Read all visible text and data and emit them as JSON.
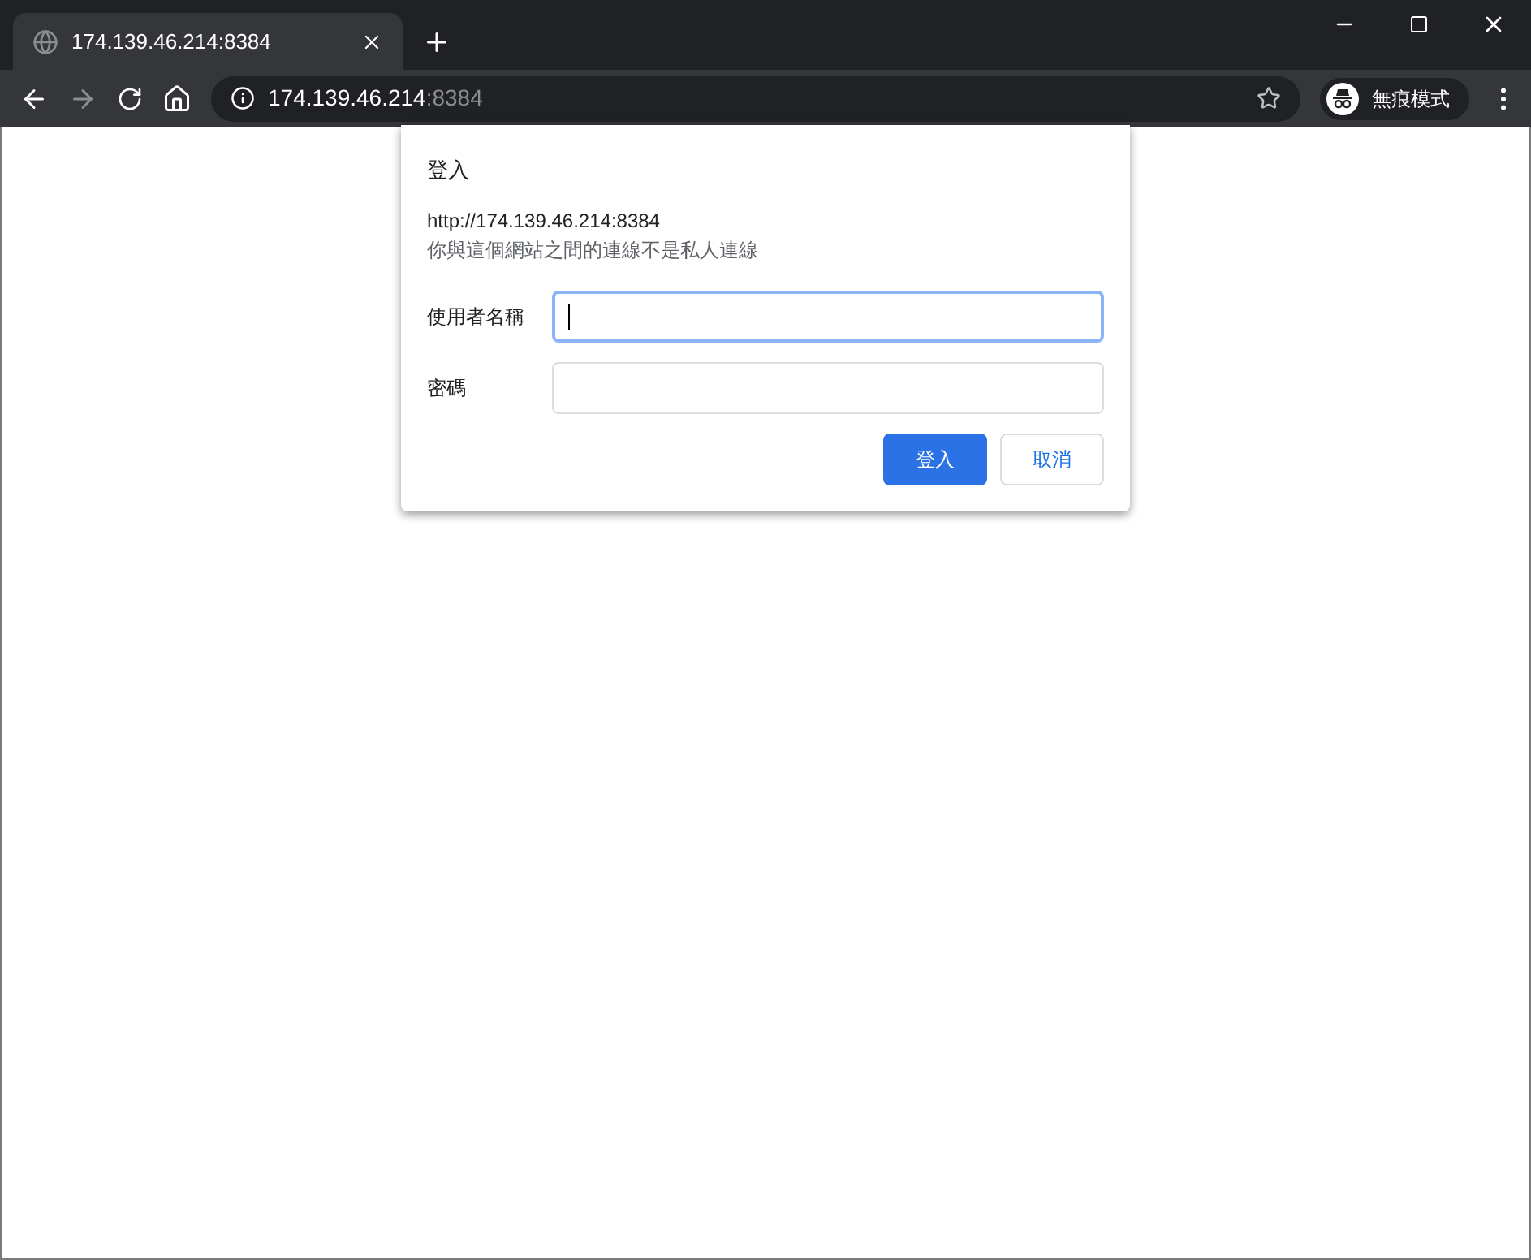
{
  "tab": {
    "title": "174.139.46.214:8384",
    "selected": true
  },
  "address_bar": {
    "host": "174.139.46.214",
    "port": ":8384"
  },
  "incognito": {
    "label": "無痕模式"
  },
  "dialog": {
    "title": "登入",
    "origin": "http://174.139.46.214:8384",
    "warning": "你與這個網站之間的連線不是私人連線",
    "fields": [
      {
        "label": "使用者名稱",
        "focused": true
      },
      {
        "label": "密碼",
        "focused": false
      }
    ],
    "buttons": [
      {
        "label": "登入",
        "kind": "primary"
      },
      {
        "label": "取消",
        "kind": "secondary"
      }
    ]
  }
}
